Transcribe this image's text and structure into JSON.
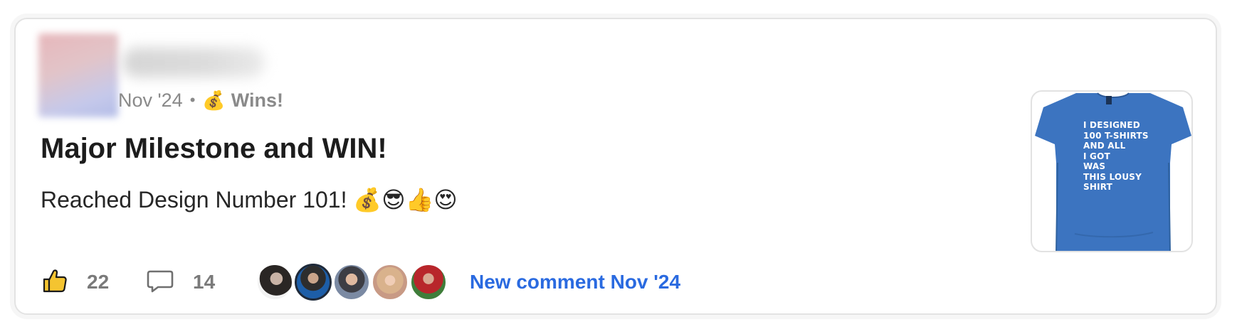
{
  "post": {
    "date": "Nov '24",
    "separator": "•",
    "category_emoji": "💰",
    "category": "Wins!",
    "title": "Major Milestone and WIN!",
    "body": "Reached Design Number 101! 💰😎👍😍",
    "likes": "22",
    "comments": "14",
    "new_comment": "New comment Nov '24",
    "commenter_icons": [
      "avatar",
      "avatar",
      "avatar",
      "avatar",
      "avatar"
    ],
    "thumbnail": {
      "shirt_text": "I DESIGNED\n100 T-SHIRTS\nAND ALL\nI GOT\nWAS\nTHIS LOUSY\nSHIRT",
      "shirt_color": "#3c74c0"
    }
  },
  "colors": {
    "accent": "#2a6ae0",
    "muted": "#8a8a8a",
    "title": "#1c1c1c"
  },
  "icons": {
    "like": "thumbs-up-icon",
    "comment": "comment-bubble-icon"
  }
}
